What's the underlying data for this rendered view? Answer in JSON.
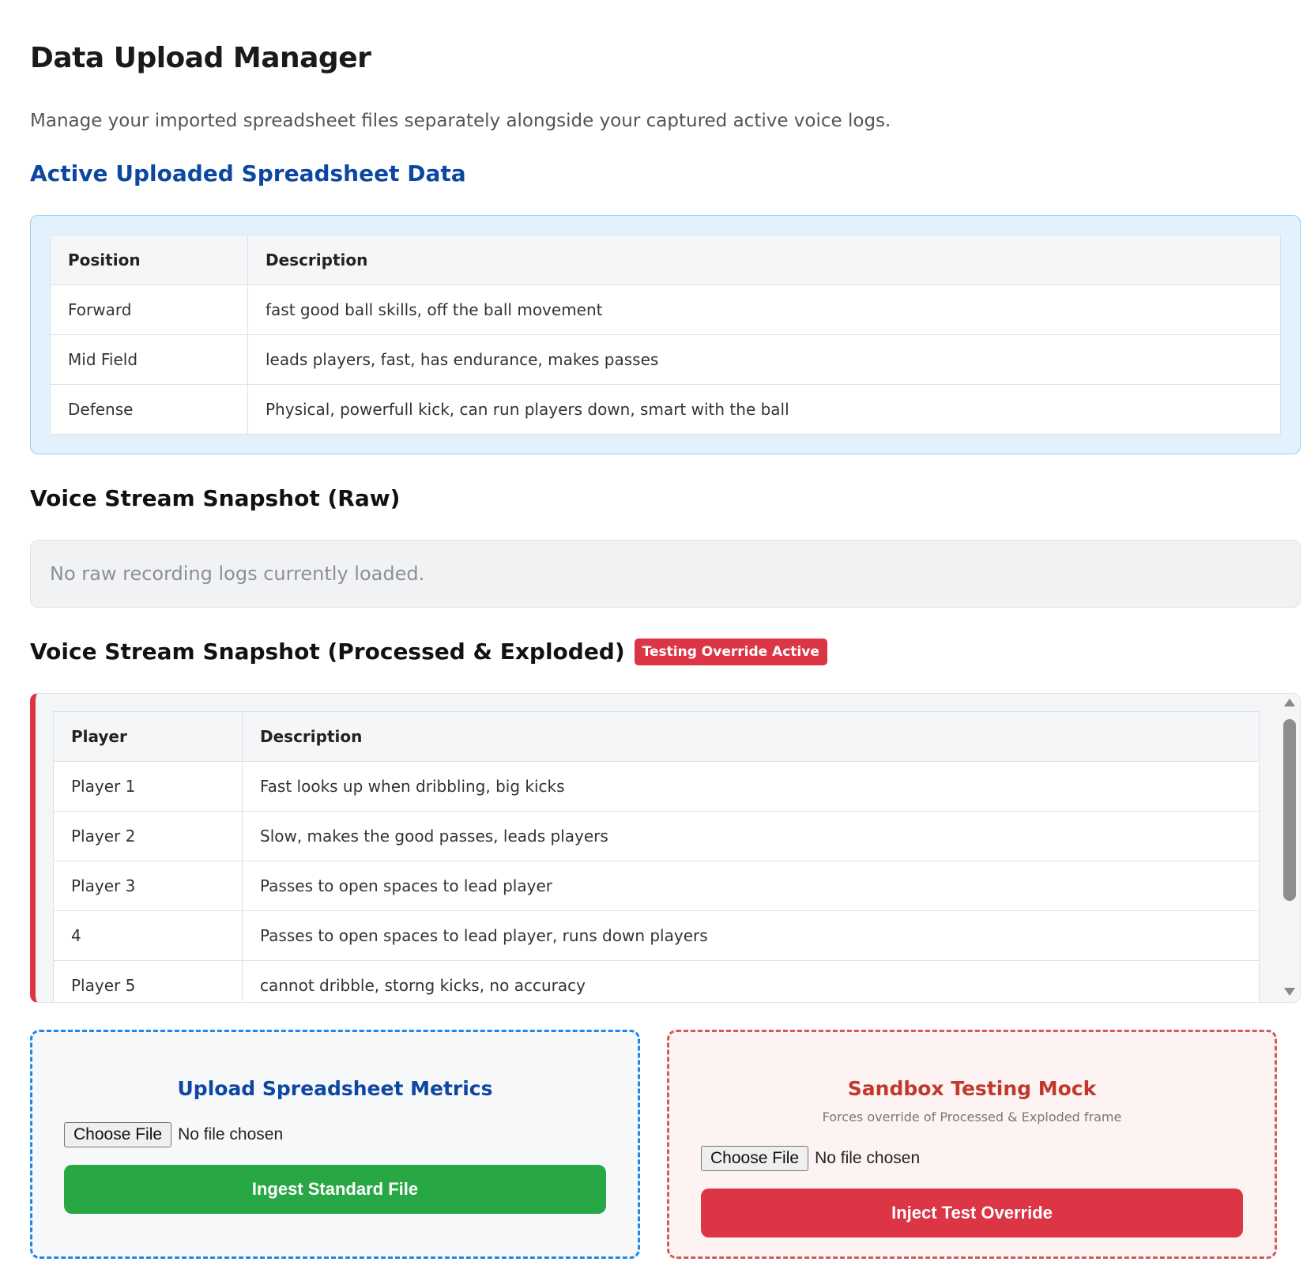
{
  "page": {
    "title": "Data Upload Manager",
    "subtitle": "Manage your imported spreadsheet files separately alongside your captured active voice logs."
  },
  "spreadsheet": {
    "heading": "Active Uploaded Spreadsheet Data",
    "columns": [
      "Position",
      "Description"
    ],
    "rows": [
      [
        "Forward",
        "fast good ball skills, off the ball movement"
      ],
      [
        "Mid Field",
        "leads players, fast, has endurance, makes passes"
      ],
      [
        "Defense",
        "Physical, powerfull kick, can run players down, smart with the ball"
      ]
    ]
  },
  "voice_raw": {
    "heading": "Voice Stream Snapshot (Raw)",
    "empty_text": "No raw recording logs currently loaded."
  },
  "voice_processed": {
    "heading": "Voice Stream Snapshot (Processed & Exploded)",
    "badge": "Testing Override Active",
    "columns": [
      "Player",
      "Description"
    ],
    "rows": [
      [
        "Player 1",
        "Fast looks up when dribbling, big kicks"
      ],
      [
        "Player 2",
        "Slow, makes the good passes, leads players"
      ],
      [
        "Player 3",
        "Passes to open spaces to lead player"
      ],
      [
        "4",
        "Passes to open spaces to lead player, runs down players"
      ],
      [
        "Player 5",
        "cannot dribble, storng kicks, no accuracy"
      ]
    ]
  },
  "upload_card": {
    "title": "Upload Spreadsheet Metrics",
    "choose_label": "Choose File",
    "file_status": "No file chosen",
    "button_label": "Ingest Standard File"
  },
  "sandbox_card": {
    "title": "Sandbox Testing Mock",
    "subtitle": "Forces override of Processed & Exploded frame",
    "choose_label": "Choose File",
    "file_status": "No file chosen",
    "button_label": "Inject Test Override"
  },
  "colors": {
    "accent_blue": "#0d47a1",
    "success_green": "#28a745",
    "danger_red": "#dc3545"
  }
}
